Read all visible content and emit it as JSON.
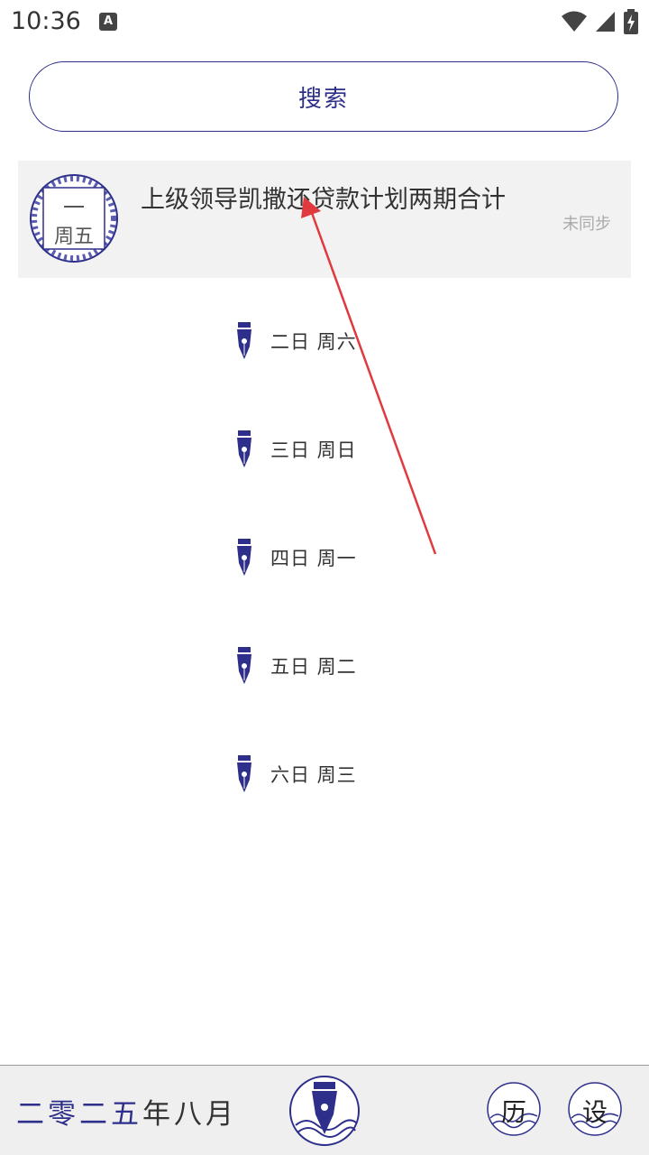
{
  "status_bar": {
    "time": "10:36",
    "notification_icon": "A"
  },
  "search": {
    "label": "搜索"
  },
  "entry": {
    "badge_day": "一",
    "badge_weekday": "周五",
    "title": "上级领导凯撒还贷款计划两期合计",
    "sync_status": "未同步"
  },
  "days": [
    {
      "label": "二日 周六"
    },
    {
      "label": "三日 周日"
    },
    {
      "label": "四日 周一"
    },
    {
      "label": "五日 周二"
    },
    {
      "label": "六日 周三"
    }
  ],
  "bottom_bar": {
    "month_parts": [
      "二零二五",
      "年",
      "八",
      "月"
    ],
    "calendar_button": "历",
    "settings_button": "设"
  },
  "colors": {
    "accent": "#2d2f8a",
    "annotation_arrow": "#e0393e"
  }
}
